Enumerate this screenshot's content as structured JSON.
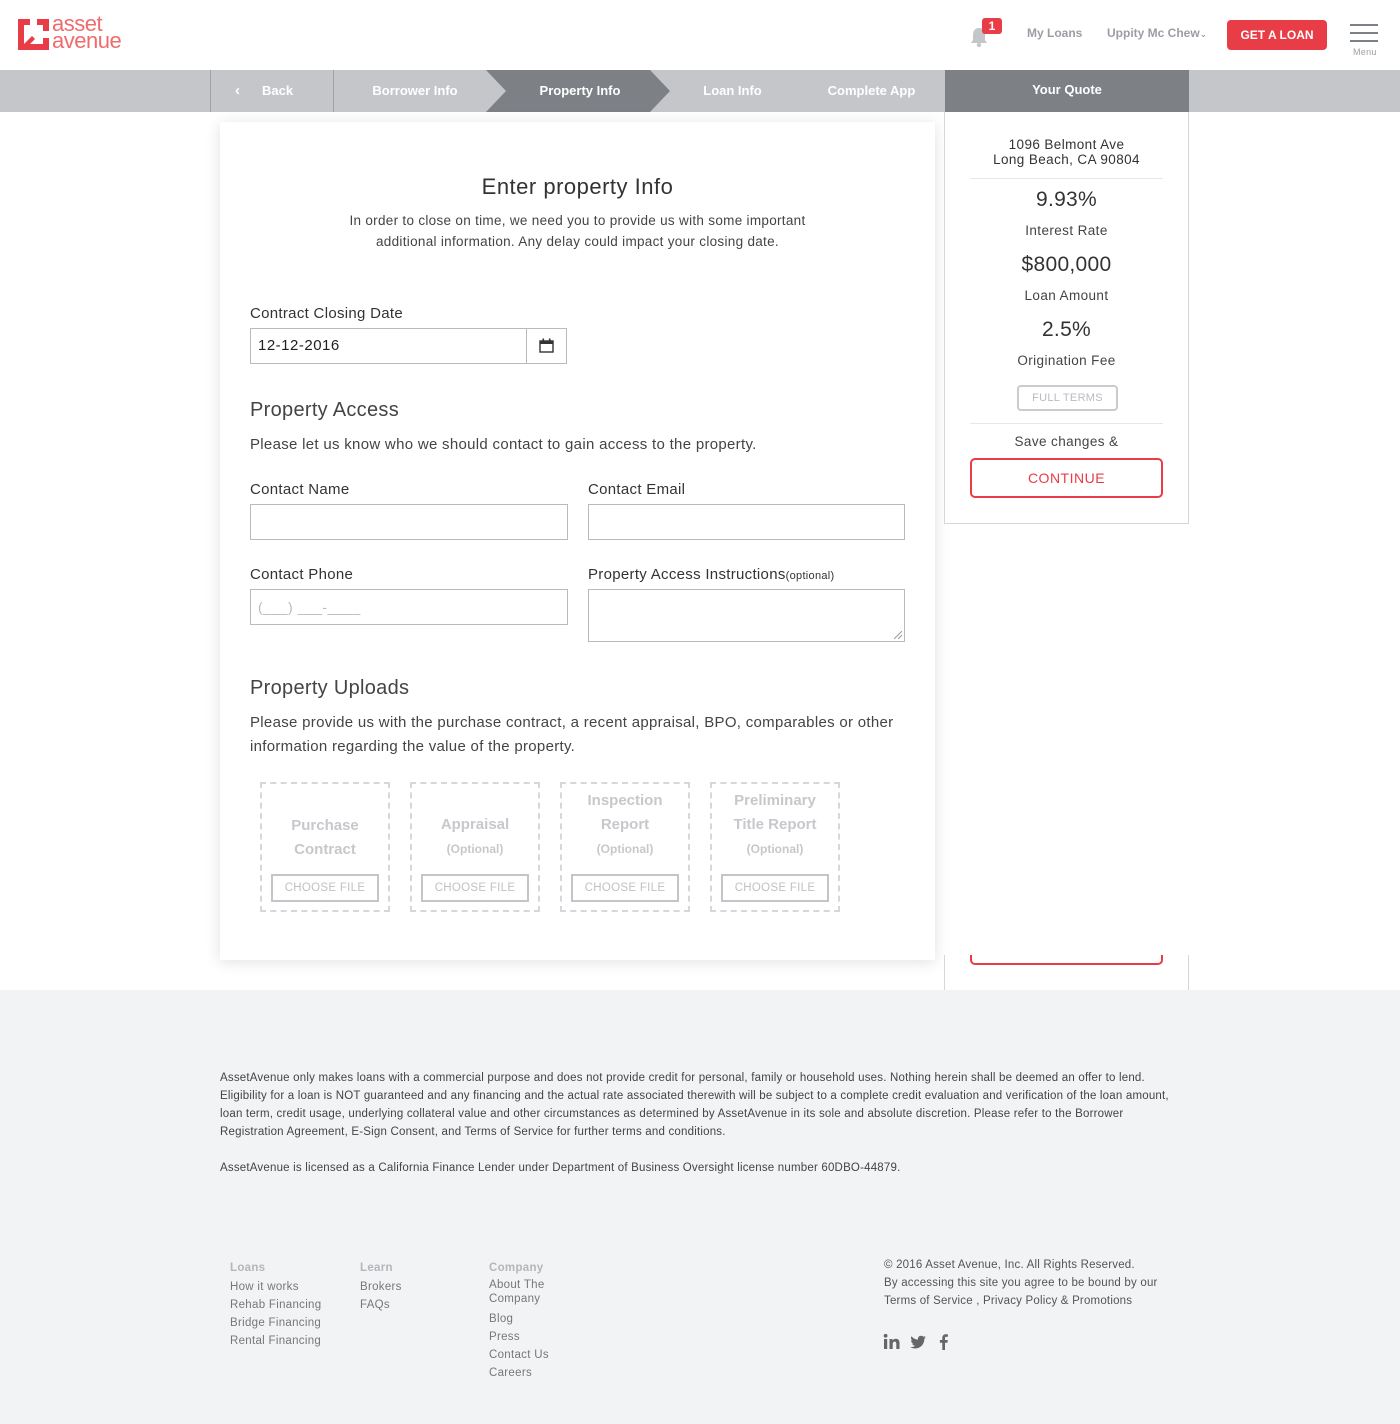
{
  "brand": {
    "logo_line1": "asset",
    "logo_line2": "avenue",
    "accent_color": "#e83c46",
    "logo_color": "#ee6c6c"
  },
  "header": {
    "notification_count": "1",
    "my_loans": "My Loans",
    "user_name": "Uppity Mc Chew",
    "get_loan": "GET A LOAN",
    "menu_label": "Menu"
  },
  "steps": {
    "back": "Back",
    "items": [
      "Borrower Info",
      "Property Info",
      "Loan Info",
      "Complete App"
    ],
    "active": "Property Info",
    "your_quote": "Your Quote"
  },
  "form": {
    "title": "Enter property Info",
    "subtitle": "In order to close on time, we need you to provide us with some important additional information. Any delay could impact your closing date.",
    "closing_date_label": "Contract Closing Date",
    "closing_date_value": "12-12-2016",
    "access_heading": "Property Access",
    "access_text": "Please let us know who we should contact to gain access to the property.",
    "contact_name_label": "Contact Name",
    "contact_email_label": "Contact Email",
    "contact_phone_label": "Contact Phone",
    "contact_phone_placeholder": "(___) ___-____",
    "instructions_label": "Property Access Instructions",
    "instructions_optional": "(optional)",
    "uploads_heading": "Property Uploads",
    "uploads_text": "Please provide us with the purchase contract, a recent appraisal, BPO, comparables or other information regarding the value of the property.",
    "uploads": [
      {
        "title_line1": "Purchase",
        "title_line2": "Contract",
        "optional": "",
        "button": "CHOOSE FILE"
      },
      {
        "title_line1": "Appraisal",
        "title_line2": "",
        "optional": "(Optional)",
        "button": "CHOOSE FILE"
      },
      {
        "title_line1": "Inspection",
        "title_line2": "Report",
        "optional": "(Optional)",
        "button": "CHOOSE FILE"
      },
      {
        "title_line1": "Preliminary",
        "title_line2": "Title Report",
        "optional": "(Optional)",
        "button": "CHOOSE FILE"
      }
    ]
  },
  "quote": {
    "address_line1": "1096 Belmont Ave",
    "address_line2": "Long Beach, CA 90804",
    "interest_rate": "9.93%",
    "interest_rate_label": "Interest Rate",
    "loan_amount": "$800,000",
    "loan_amount_label": "Loan Amount",
    "origination_fee": "2.5%",
    "origination_fee_label": "Origination Fee",
    "full_terms": "FULL TERMS",
    "save_text": "Save changes &",
    "continue": "CONTINUE"
  },
  "footer": {
    "disclaimer": "AssetAvenue only makes loans with a commercial purpose and does not provide credit for personal, family or household uses. Nothing herein shall be deemed an offer to lend. Eligibility for a loan is NOT guaranteed and any financing and the actual rate associated therewith will be subject to a complete credit evaluation and verification of the loan amount, loan term, credit usage, underlying collateral value and other circumstances as determined by AssetAvenue in its sole and absolute discretion. Please refer to the Borrower Registration Agreement, E-Sign Consent, and Terms of Service for further terms and conditions.",
    "license": "AssetAvenue is licensed as a California Finance Lender under Department of Business Oversight license number 60DBO-44879.",
    "loans": {
      "heading": "Loans",
      "items": [
        "How it works",
        "Rehab Financing",
        "Bridge Financing",
        "Rental Financing"
      ]
    },
    "learn": {
      "heading": "Learn",
      "items": [
        "Brokers",
        "FAQs"
      ]
    },
    "company": {
      "heading": "Company",
      "items": [
        "About The Company",
        "Blog",
        "Press",
        "Contact Us",
        "Careers"
      ]
    },
    "copyright": "© 2016 Asset Avenue, Inc. All Rights Reserved.",
    "agree_text": "By accessing this site you agree to be bound by our",
    "terms": "Terms of Service",
    "privacy": "Privacy Policy & Promotions",
    "social": [
      "linkedin-icon",
      "twitter-icon",
      "facebook-icon"
    ]
  }
}
